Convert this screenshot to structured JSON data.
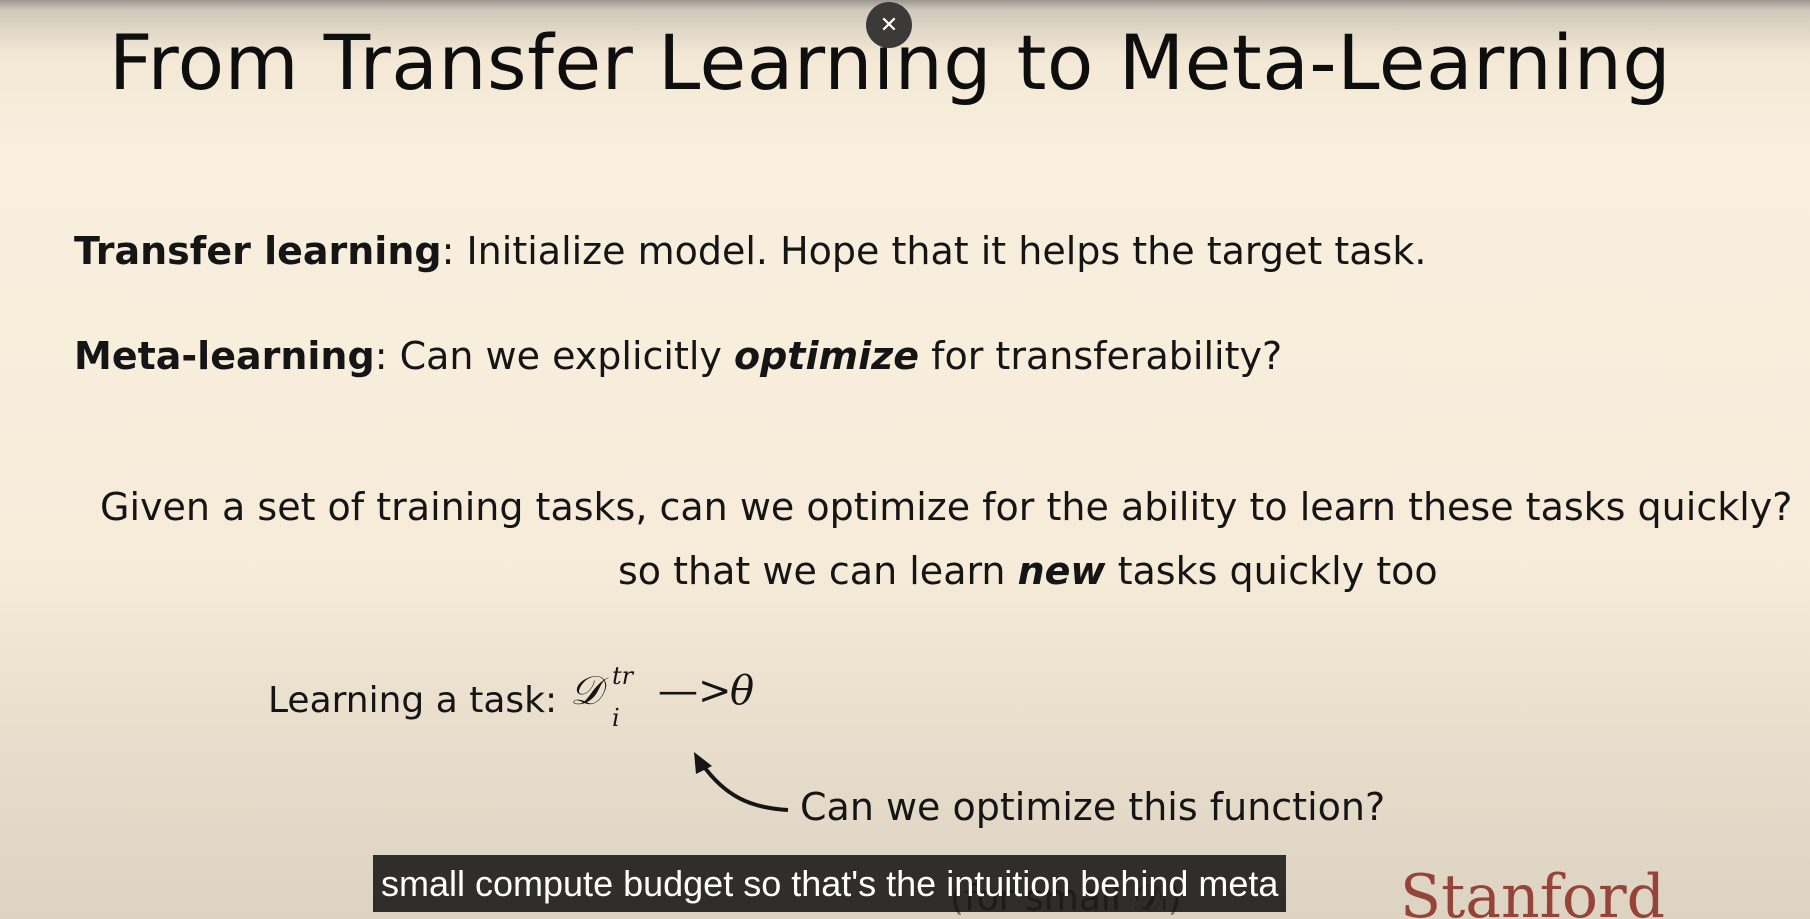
{
  "overlay": {
    "close_icon": "close-icon"
  },
  "slide": {
    "title": "From Transfer Learning to Meta-Learning",
    "transfer": {
      "term": "Transfer learning",
      "text": ": Initialize model. Hope that it helps the target task."
    },
    "meta": {
      "term": "Meta-learning",
      "text_before": ": Can we explicitly ",
      "emphasis": "optimize",
      "text_after": " for transferability?"
    },
    "given_line": "Given a set of training tasks, can we optimize for the ability to learn these tasks quickly?",
    "so_that": {
      "before": "so that we can learn ",
      "emphasis": "new",
      "after": " tasks quickly too"
    },
    "learning_task": {
      "label": "Learning a task:",
      "math_symbol": "𝒟",
      "sup": "tr",
      "sub": "i",
      "arrow": "—>",
      "result": "θ"
    },
    "question": "Can we optimize this function?",
    "logo_text": "Stanford"
  },
  "caption": {
    "text": "small compute budget so that's the intuition behind meta"
  },
  "colors": {
    "background": "#f7ecd8",
    "text": "#151515",
    "caption_bg": "#0b0b0b",
    "logo": "#8a2a22"
  }
}
